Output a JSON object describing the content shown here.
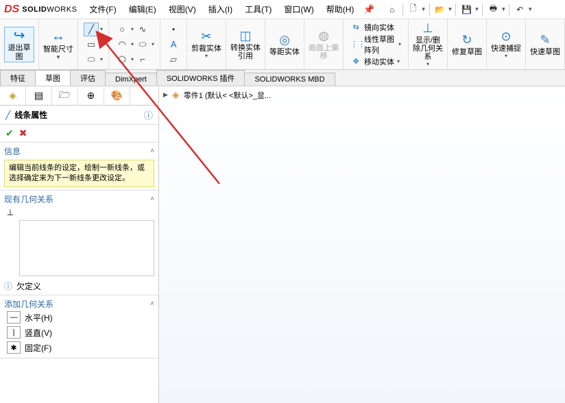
{
  "app": {
    "logo_ds": "DS",
    "logo_solid": "SOLID",
    "logo_works": "WORKS"
  },
  "menu": {
    "file": "文件(F)",
    "edit": "编辑(E)",
    "view": "视图(V)",
    "insert": "插入(I)",
    "tools": "工具(T)",
    "window": "窗口(W)",
    "help": "帮助(H)"
  },
  "ribbon": {
    "exit_sketch": "退出草图",
    "smart_dim": "智能尺寸",
    "trim": "剪裁实体",
    "convert": "转换实体引用",
    "offset": "等距实体",
    "surface_offset": "曲面上偏移",
    "mirror": "镜向实体",
    "linear_pattern": "线性草图阵列",
    "move": "移动实体",
    "show_hide": "显示/删除几何关系",
    "repair": "修复草图",
    "quick_snap": "快速捕捉",
    "quick_sketch": "快速草图"
  },
  "tabs": {
    "feature": "特征",
    "sketch": "草图",
    "evaluate": "评估",
    "dimxpert": "DimXpert",
    "addins": "SOLIDWORKS 插件",
    "mbd": "SOLIDWORKS MBD"
  },
  "panel": {
    "title": "线条属性",
    "info_h": "信息",
    "info_text": "编辑当前线条的设定，绘制一新线条，或选择确定来为下一新线条更改设定。",
    "existing_h": "现有几何关系",
    "underdef": "欠定义",
    "add_h": "添加几何关系",
    "horiz": "水平(H)",
    "vert": "竖直(V)",
    "fix": "固定(F)"
  },
  "breadcrumb": {
    "part": "零件1  (默认< <默认>_显..."
  }
}
